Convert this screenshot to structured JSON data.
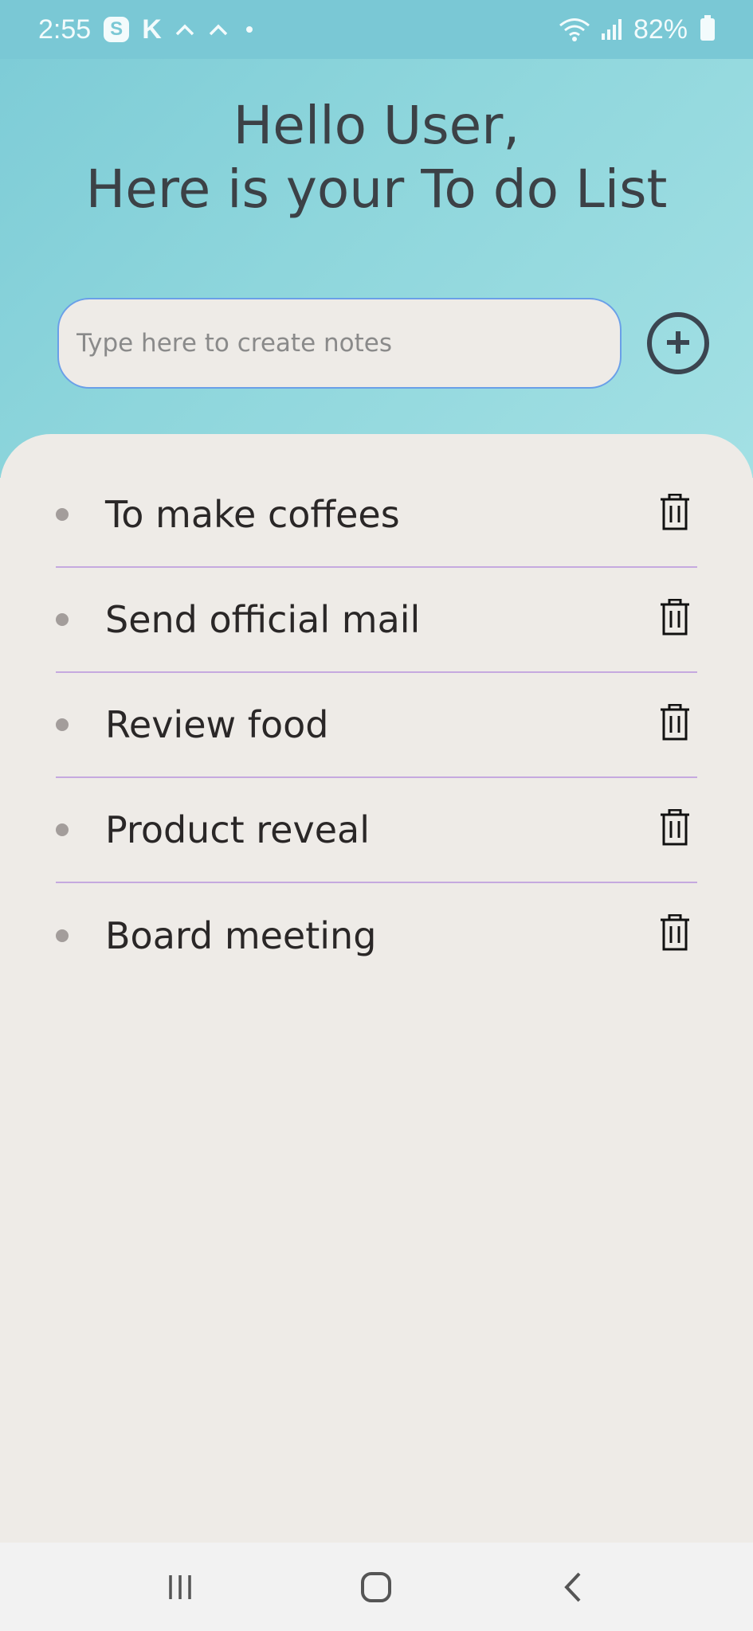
{
  "status_bar": {
    "time": "2:55",
    "battery": "82%",
    "notification_icons": [
      "skype-icon",
      "k-icon",
      "caret-up-icon",
      "caret-up-icon",
      "dot-icon"
    ],
    "system_icons": [
      "wifi-icon",
      "signal-icon",
      "battery-icon"
    ]
  },
  "header": {
    "greeting": "Hello User,",
    "subtitle": "Here is your To do List"
  },
  "note_input": {
    "placeholder": "Type here to create notes",
    "value": ""
  },
  "add_button": {
    "icon": "plus-circle-icon"
  },
  "todos": [
    {
      "text": "To make coffees",
      "icon": "trash-icon"
    },
    {
      "text": "Send official mail",
      "icon": "trash-icon"
    },
    {
      "text": "Review food",
      "icon": "trash-icon"
    },
    {
      "text": "Product reveal",
      "icon": "trash-icon"
    },
    {
      "text": "Board meeting",
      "icon": "trash-icon"
    }
  ],
  "nav_bar": {
    "buttons": [
      "recents-icon",
      "home-icon",
      "back-icon"
    ]
  },
  "colors": {
    "header_bg": "#8ed6dc",
    "status_bar_bg": "#7ac8d5",
    "panel_bg": "#eeebe7",
    "divider": "#c5a9df",
    "input_border": "#6a9fe8",
    "text_dark": "#2a2727"
  }
}
